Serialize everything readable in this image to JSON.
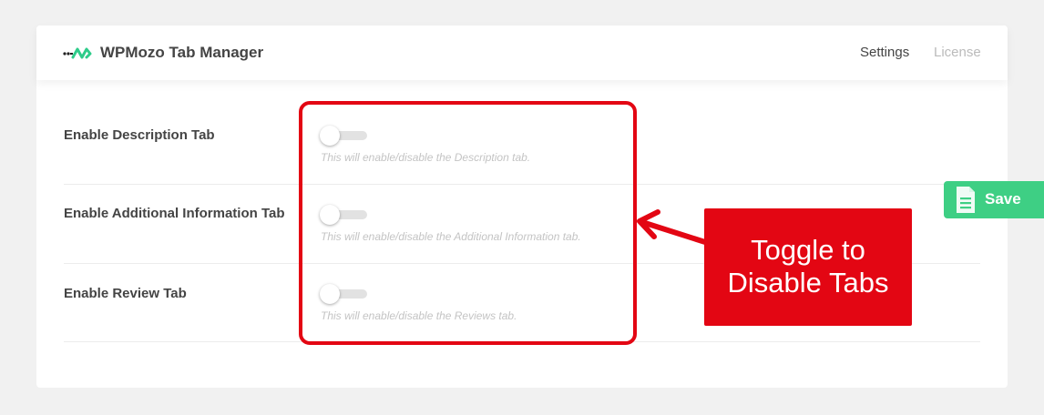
{
  "header": {
    "logo_icon": "wpmozo-logo-icon",
    "title": "WPMozo Tab Manager",
    "nav": [
      {
        "label": "Settings",
        "active": true
      },
      {
        "label": "License",
        "active": false
      }
    ]
  },
  "settings": [
    {
      "label": "Enable Description Tab",
      "enabled": false,
      "description": "This will enable/disable the Description tab."
    },
    {
      "label": "Enable Additional Information Tab",
      "enabled": false,
      "description": "This will enable/disable the Additional Information tab."
    },
    {
      "label": "Enable Review Tab",
      "enabled": false,
      "description": "This will enable/disable the Reviews tab."
    }
  ],
  "annotation": {
    "line1": "Toggle to",
    "line2": "Disable Tabs",
    "color": "#e30613"
  },
  "save": {
    "label": "Save",
    "icon": "document-icon",
    "color": "#3ecf84"
  }
}
